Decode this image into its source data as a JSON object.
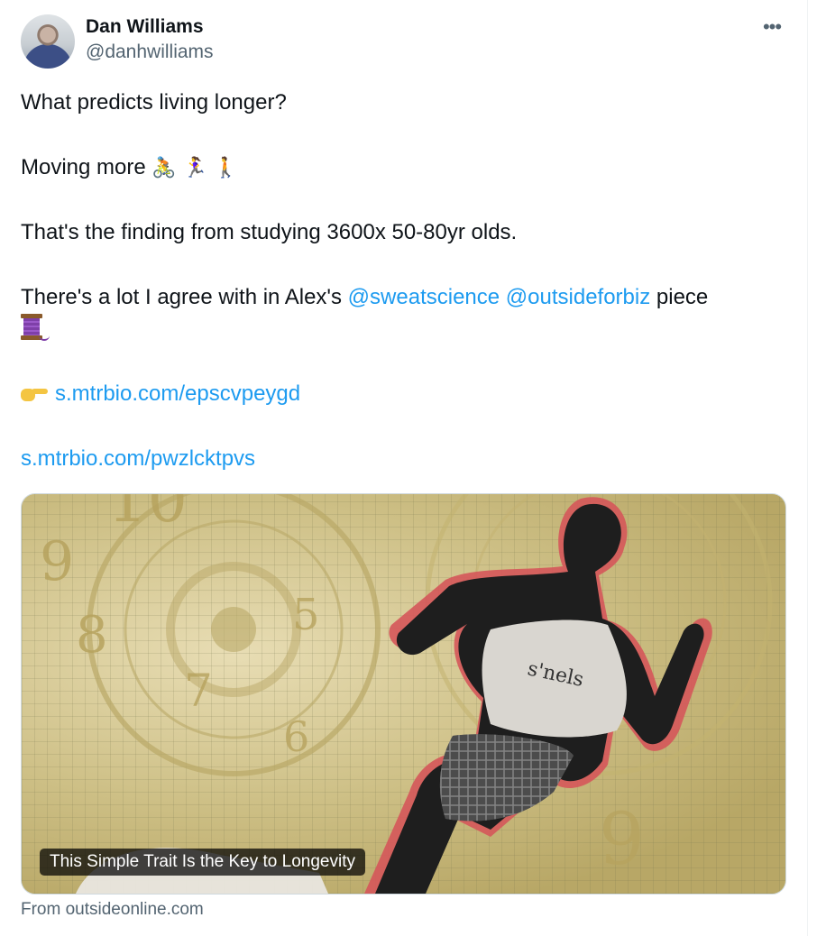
{
  "author": {
    "display_name": "Dan Williams",
    "handle": "@danhwilliams"
  },
  "tweet": {
    "line1": "What predicts living longer?",
    "line2_text": "Moving more ",
    "line2_emojis": [
      "🚴",
      "🏃‍♀️",
      "🚶"
    ],
    "line3": "That's the finding from studying 3600x 50-80yr olds.",
    "line4_prefix": "There's a lot I agree with  in Alex's ",
    "mention1": "@sweatscience",
    "mention2": "@outsideforbiz",
    "line4_suffix": " piece",
    "link1": "s.mtrbio.com/epscvpeygd",
    "link2": "s.mtrbio.com/pwzlcktpvs"
  },
  "icons": {
    "more": "more-horizontal-icon",
    "thread": "spool-of-thread-icon",
    "pointer": "pointing-right-hand-icon"
  },
  "card": {
    "caption": "This Simple Trait Is the Key to Longevity",
    "source": "From outsideonline.com"
  },
  "colors": {
    "link": "#1d9bf0",
    "text": "#0f1419",
    "secondary": "#536471",
    "border": "#cfd9de"
  }
}
